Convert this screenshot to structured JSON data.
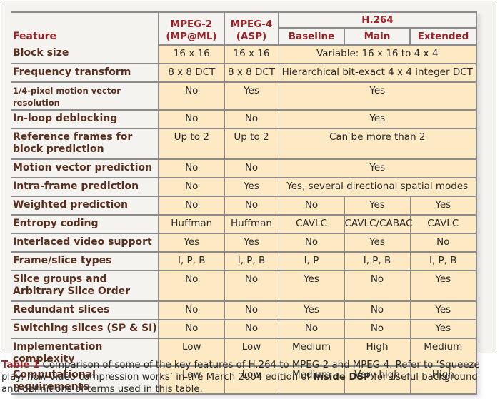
{
  "table": {
    "header": {
      "feature": "Feature",
      "mpeg2": "MPEG-2 (MP@ML)",
      "mpeg2_l1": "MPEG-2",
      "mpeg2_l2": "(MP@ML)",
      "mpeg4_l1": "MPEG-4",
      "mpeg4_l2": "(ASP)",
      "h264": "H.264",
      "h264_profiles": [
        "Baseline",
        "Main",
        "Extended"
      ]
    },
    "rows": [
      {
        "feature": "Block size",
        "mpeg2": "16 x 16",
        "mpeg4": "16 x 16",
        "h264_all": "Variable: 16 x 16 to 4 x 4"
      },
      {
        "feature": "Frequency transform",
        "mpeg2": "8 x 8 DCT",
        "mpeg4": "8 x 8 DCT",
        "h264_all": "Hierarchical bit-exact 4 x 4 integer DCT"
      },
      {
        "feature": "1/4-pixel motion vector resolution",
        "mpeg2": "No",
        "mpeg4": "Yes",
        "h264_all": "Yes"
      },
      {
        "feature": "In-loop deblocking",
        "mpeg2": "No",
        "mpeg4": "No",
        "h264_all": "Yes"
      },
      {
        "feature": "Reference frames for block prediction",
        "mpeg2": "Up to 2",
        "mpeg4": "Up to 2",
        "h264_all": "Can be more than 2"
      },
      {
        "feature": "Motion vector prediction",
        "mpeg2": "No",
        "mpeg4": "No",
        "h264_all": "Yes"
      },
      {
        "feature": "Intra-frame prediction",
        "mpeg2": "No",
        "mpeg4": "Yes",
        "h264_all": "Yes, several directional spatial modes"
      },
      {
        "feature": "Weighted prediction",
        "mpeg2": "No",
        "mpeg4": "No",
        "baseline": "No",
        "main": "Yes",
        "extended": "Yes"
      },
      {
        "feature": "Entropy coding",
        "mpeg2": "Huffman",
        "mpeg4": "Huffman",
        "baseline": "CAVLC",
        "main": "CAVLC/CABAC",
        "extended": "CAVLC"
      },
      {
        "feature": "Interlaced video support",
        "mpeg2": "Yes",
        "mpeg4": "Yes",
        "baseline": "No",
        "main": "Yes",
        "extended": "No"
      },
      {
        "feature": "Frame/slice types",
        "mpeg2": "I, P, B",
        "mpeg4": "I, P, B",
        "baseline": "I, P",
        "main": "I, P, B",
        "extended": "I, P, B"
      },
      {
        "feature": "Slice groups and Arbitrary Slice Order",
        "mpeg2": "No",
        "mpeg4": "No",
        "baseline": "Yes",
        "main": "No",
        "extended": "Yes"
      },
      {
        "feature": "Redundant slices",
        "mpeg2": "No",
        "mpeg4": "No",
        "baseline": "Yes",
        "main": "No",
        "extended": "Yes"
      },
      {
        "feature": "Switching slices (SP & SI)",
        "mpeg2": "No",
        "mpeg4": "No",
        "baseline": "No",
        "main": "No",
        "extended": "Yes"
      },
      {
        "feature": "Implementation complexity",
        "mpeg2": "Low",
        "mpeg4": "Low",
        "baseline": "Medium",
        "main": "High",
        "extended": "Medium"
      },
      {
        "feature": "Computational requirements",
        "mpeg2": "Low",
        "mpeg4": "Low",
        "baseline": "Medium",
        "main": "Very high",
        "extended": "High"
      }
    ]
  },
  "caption": {
    "label": "Table 1",
    "text_1": " Comparison of some of the key features of H.264 to MPEG-2 and MPEG-4. Refer to ‘Squeeze play: how video compression works’ in the March 2004 edition of ",
    "publication": "Inside DSP",
    "text_2": " for useful background and definitions of terms used in this table."
  },
  "colors": {
    "header_text": "#9a2329",
    "feature_text": "#5a2e1e",
    "cell_bg": "#fde9c4",
    "panel_bg": "#f4f3ef",
    "border": "#8c8c8c"
  }
}
